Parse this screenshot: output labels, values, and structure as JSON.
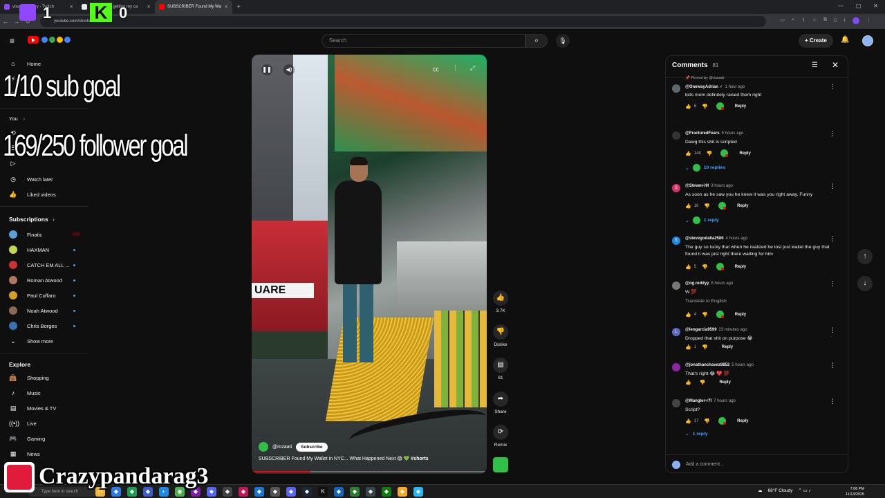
{
  "browser": {
    "tabs": [
      {
        "label": "vousten_tuary - Twitch",
        "active": false,
        "color": "#9146ff"
      },
      {
        "label": "Someone is getting my ca",
        "active": false,
        "color": "#e8eaed"
      },
      {
        "label": "SUBSCRIBER Found My Wa",
        "active": true,
        "color": "#ff0000"
      }
    ],
    "url": "youtube.com/shorts/"
  },
  "stream_overlay": {
    "twitch_count": "1",
    "kick_letter": "K",
    "kick_count": "0",
    "sub_goal": "1/10 sub goal",
    "follower_goal": "169/250 follower goal",
    "handle": "Crazypandarag3"
  },
  "header": {
    "search_placeholder": "Search",
    "create_label": "Create"
  },
  "sidebar": {
    "home": "Home",
    "you": "You",
    "watch_later": "Watch later",
    "liked_videos": "Liked videos",
    "subscriptions_heading": "Subscriptions",
    "subscriptions": [
      {
        "name": "Finatic",
        "color": "#5aa0d8",
        "live": true
      },
      {
        "name": "HAXMAN",
        "color": "#c2d94a",
        "live": false
      },
      {
        "name": "CATCH EM ALL ...",
        "color": "#c33",
        "live": false
      },
      {
        "name": "Roman Atwood",
        "color": "#b07a60",
        "live": false
      },
      {
        "name": "Paul Cuffaro",
        "color": "#d6a020",
        "live": false
      },
      {
        "name": "Noah Atwood",
        "color": "#8a6a55",
        "live": false
      },
      {
        "name": "Chris Borges",
        "color": "#3a6fb0",
        "live": false
      }
    ],
    "show_more": "Show more",
    "explore_heading": "Explore",
    "explore": [
      {
        "label": "Shopping",
        "icon": "shopping-bag-icon"
      },
      {
        "label": "Music",
        "icon": "music-note-icon"
      },
      {
        "label": "Movies & TV",
        "icon": "film-icon"
      },
      {
        "label": "Live",
        "icon": "live-icon"
      },
      {
        "label": "Gaming",
        "icon": "gamepad-icon"
      },
      {
        "label": "News",
        "icon": "news-icon"
      }
    ]
  },
  "video": {
    "channel": "@rozaati",
    "subscribe_label": "Subscribe",
    "title": "SUBSCRIBER Found My Wallet in NYC... What Happened Next 😱 💚",
    "hashtag": "#shorts",
    "sign_text": "UARE",
    "progress": 0.25
  },
  "actions": {
    "likes": "3.7K",
    "dislike_label": "Dislike",
    "comments_count": "81",
    "share_label": "Share",
    "remix_label": "Remix"
  },
  "comments": {
    "title": "Comments",
    "count": "81",
    "add_placeholder": "Add a comment...",
    "items": [
      {
        "pinned": "Pinned by @rozaati",
        "author": "@OnewayAdrian ✓",
        "time": "1 hour ago",
        "text": "kids mom definitely raised them right",
        "likes": "6",
        "avatar_color": "#5a6b6f",
        "letter": "",
        "replies": ""
      },
      {
        "pinned": "",
        "author": "@FracturedFears",
        "time": "5 hours ago",
        "text": "Dawg this shit is scripted",
        "likes": "148",
        "avatar_color": "#333",
        "letter": "",
        "replies": "10 replies"
      },
      {
        "pinned": "",
        "author": "@Steven-i9l",
        "time": "3 hours ago",
        "text": "As soon as he saw you he knew it was you right away.  Funny",
        "likes": "16",
        "avatar_color": "#d6336c",
        "letter": "S",
        "replies": "1 reply"
      },
      {
        "pinned": "",
        "author": "@stevegodalla2586",
        "time": "4 hours ago",
        "text": "The guy so lucky that when he realized he lost just wallet the guy that found it was just right there waiting for him",
        "likes": "5",
        "avatar_color": "#1e88e5",
        "letter": "S",
        "replies": ""
      },
      {
        "pinned": "",
        "author": "@og.reddyy",
        "time": "8 hours ago",
        "text": "W 💯",
        "translate": "Translate to English",
        "likes": "4",
        "avatar_color": "#777",
        "letter": "",
        "replies": ""
      },
      {
        "pinned": "",
        "author": "@leogarcia9599",
        "time": "23 minutes ago",
        "text": "Dropped that shit on purpose 😂",
        "likes": "1",
        "avatar_color": "#5c6bc0",
        "letter": "L",
        "replies": ""
      },
      {
        "pinned": "",
        "author": "@jonathanchavez8852",
        "time": "5 hours ago",
        "text": "That's right 😂 ❤️ 💯",
        "likes": "",
        "avatar_color": "#8e24aa",
        "letter": "",
        "replies": ""
      },
      {
        "pinned": "",
        "author": "@Mangler-r7l",
        "time": "7 hours ago",
        "text": "Script?",
        "likes": "17",
        "avatar_color": "#444",
        "letter": "",
        "replies": "1 reply"
      }
    ],
    "reply_label": "Reply"
  },
  "taskbar": {
    "search_placeholder": "Type here to search",
    "weather": "68°F  Cloudy",
    "time": "7:06 PM",
    "date": "11/13/2025"
  }
}
